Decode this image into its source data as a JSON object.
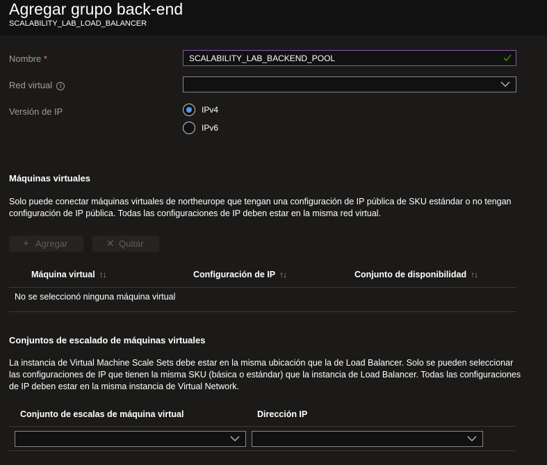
{
  "header": {
    "title": "Agregar grupo back-end",
    "subtitle": "SCALABILITY_LAB_LOAD_BALANCER"
  },
  "form": {
    "name_label": "Nombre",
    "name_required": "*",
    "name_value": "SCALABILITY_LAB_BACKEND_POOL",
    "vnet_label": "Red virtual",
    "vnet_info": "i",
    "vnet_value": "",
    "ip_version_label": "Versión de IP",
    "ip_options": [
      "IPv4",
      "IPv6"
    ],
    "ip_selected": "IPv4"
  },
  "vms": {
    "title": "Máquinas virtuales",
    "description": "Solo puede conectar máquinas virtuales de northeurope que tengan una configuración de IP pública de SKU estándar o no tengan configuración de IP pública. Todas las configuraciones de IP deben estar en la misma red virtual.",
    "add_label": "Agregar",
    "remove_label": "Quitar",
    "columns": [
      "Máquina virtual",
      "Configuración de IP",
      "Conjunto de disponibilidad"
    ],
    "sort_glyph": "↑↓",
    "empty_text": "No se seleccionó ninguna máquina virtual"
  },
  "vmss": {
    "title": "Conjuntos de escalado de máquinas virtuales",
    "description": "La instancia de Virtual Machine Scale Sets debe estar en la misma ubicación que la de Load Balancer. Solo se pueden seleccionar las configuraciones de IP que tienen la misma SKU (básica o estándar) que la instancia de Load Balancer. Todas las configuraciones de IP deben estar en la misma instancia de Virtual Network.",
    "columns": [
      "Conjunto de escalas de máquina virtual",
      "Dirección IP"
    ],
    "scale_set_value": "",
    "ip_value": ""
  },
  "colors": {
    "background": "#1b1a19",
    "input_focus_border": "#8a56a8",
    "valid_check": "#57a300",
    "radio_selected": "#4f9ae8"
  }
}
